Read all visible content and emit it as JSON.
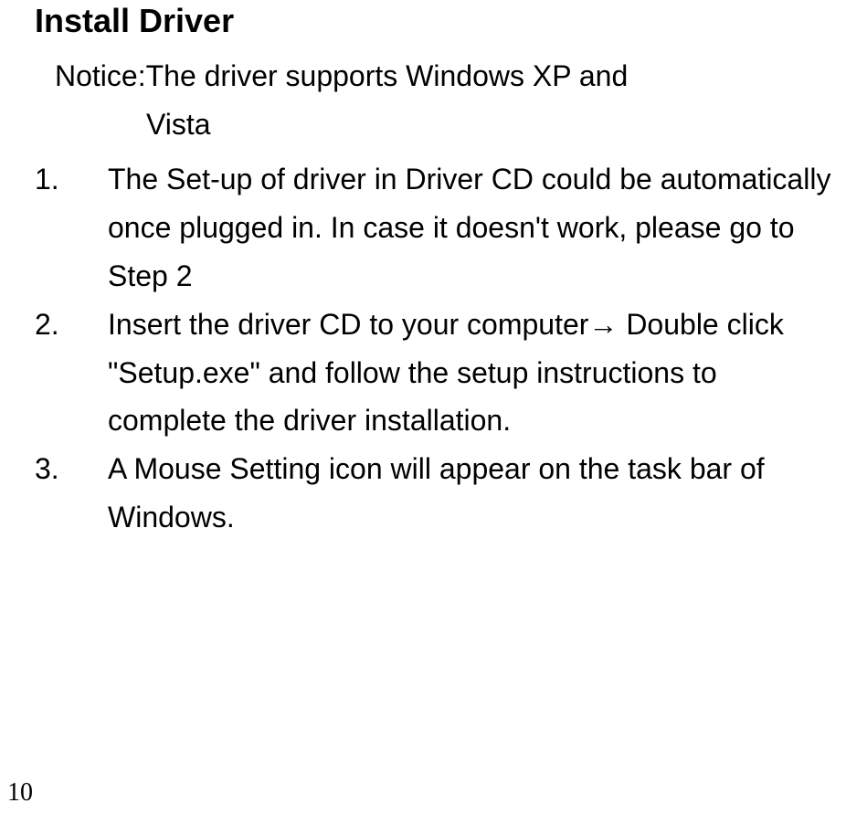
{
  "heading": "Install Driver",
  "notice": {
    "line1": "Notice:The driver supports Windows XP and",
    "line2": "Vista"
  },
  "steps": [
    {
      "number": "1.",
      "text": "The Set-up of driver in Driver CD could be automatically once plugged in. In case it doesn't work, please go to Step 2"
    },
    {
      "number": "2.",
      "text": "Insert the driver CD to your computer→ Double click \"Setup.exe\" and follow the setup instructions to complete the driver installation."
    },
    {
      "number": "3.",
      "text": "A Mouse Setting icon will appear on the task bar of Windows."
    }
  ],
  "pageNumber": "10"
}
